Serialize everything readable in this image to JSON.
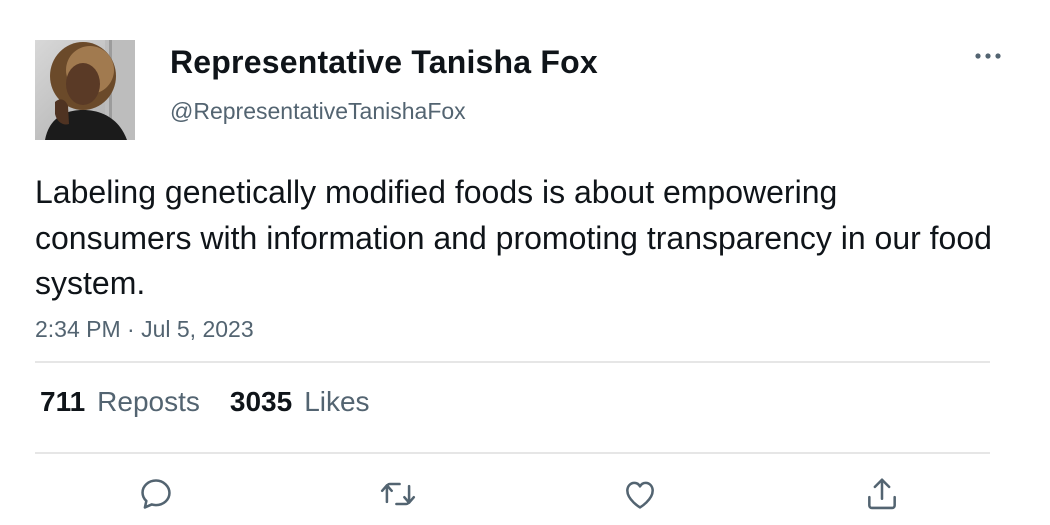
{
  "author": {
    "display_name": "Representative Tanisha Fox",
    "handle": "@RepresentativeTanishaFox"
  },
  "tweet": {
    "text": "Labeling genetically modified foods is about empowering consumers with information and promoting transparency in our food system.",
    "timestamp": "2:34 PM · Jul 5, 2023"
  },
  "stats": {
    "reposts_count": "711",
    "reposts_label": "Reposts",
    "likes_count": "3035",
    "likes_label": "Likes"
  },
  "actions": [
    "reply-icon",
    "repost-icon",
    "like-icon",
    "share-icon"
  ],
  "colors": {
    "text_primary": "#0f1419",
    "text_secondary": "#536471",
    "divider": "#e6e6e6",
    "icon": "#536471"
  }
}
